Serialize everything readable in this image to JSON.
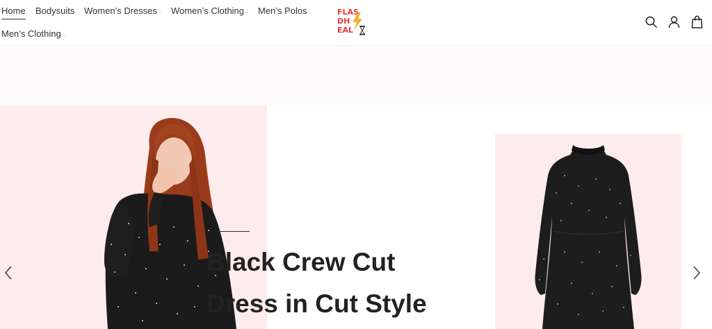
{
  "nav": {
    "items": [
      {
        "label": "Home",
        "active": true,
        "has_dropdown": false
      },
      {
        "label": "Bodysuits",
        "active": false,
        "has_dropdown": false
      },
      {
        "label": "Women’s Dresses",
        "active": false,
        "has_dropdown": true
      },
      {
        "label": "Women’s Clothing",
        "active": false,
        "has_dropdown": true
      },
      {
        "label": "Men’s Polos",
        "active": false,
        "has_dropdown": true
      },
      {
        "label": "Men’s Clothing",
        "active": false,
        "has_dropdown": true
      }
    ]
  },
  "logo": {
    "line1": "FLAS",
    "line2": "DH",
    "line3": "EAL"
  },
  "header_icons": [
    "search-icon",
    "account-icon",
    "cart-icon"
  ],
  "hero": {
    "title_line1": "Black Crew Cut",
    "title_line2": "Dress in Cut Style"
  },
  "colors": {
    "accent": "#e63b3b",
    "hero_bg": "#fdeceb",
    "bolt": "#f2b233"
  }
}
